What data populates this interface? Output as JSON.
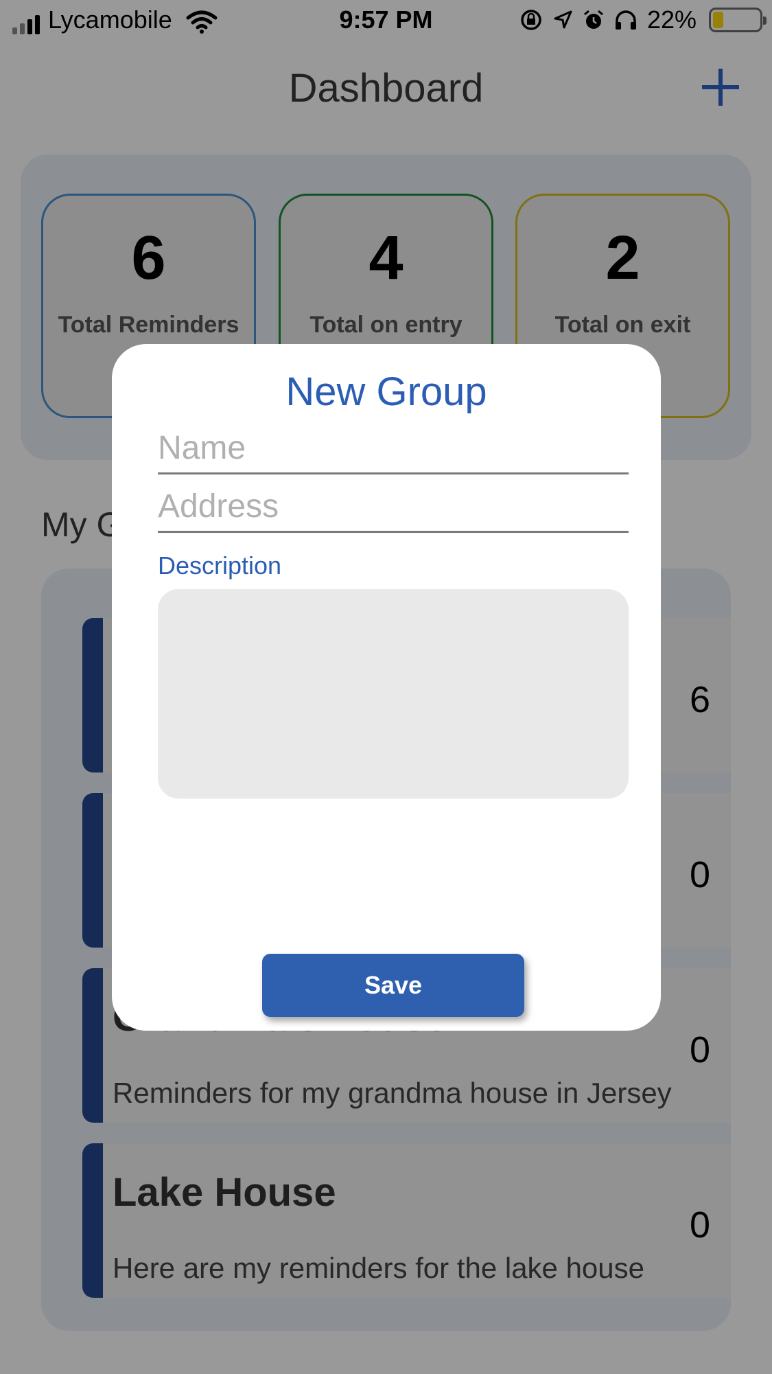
{
  "status_bar": {
    "carrier": "Lycamobile",
    "time": "9:57 PM",
    "battery_percent": "22%",
    "battery_level": 0.22,
    "icons": [
      "signal-icon",
      "wifi-icon",
      "rotation-lock-icon",
      "location-icon",
      "alarm-icon",
      "headphones-icon",
      "battery-icon"
    ]
  },
  "nav": {
    "title": "Dashboard",
    "add_icon": "plus-icon",
    "accent": "#2f62c6"
  },
  "stats": [
    {
      "value": "6",
      "label": "Total Reminders",
      "border": "#4a8fd0"
    },
    {
      "value": "4",
      "label": "Total on entry",
      "border": "#1f8a3a"
    },
    {
      "value": "2",
      "label": "Total on exit",
      "border": "#d4bd1e"
    }
  ],
  "groups_section": {
    "title": "My G",
    "items": [
      {
        "title": "",
        "count": "6",
        "description": ""
      },
      {
        "title": "",
        "count": "0",
        "description": ""
      },
      {
        "title": "Grandma's house",
        "count": "0",
        "description": "Reminders for my grandma house in Jersey"
      },
      {
        "title": "Lake House",
        "count": "0",
        "description": "Here are my reminders for the lake house"
      }
    ]
  },
  "modal": {
    "title": "New Group",
    "name_placeholder": "Name",
    "address_placeholder": "Address",
    "description_label": "Description",
    "save_label": "Save",
    "accent": "#2b5db5"
  }
}
